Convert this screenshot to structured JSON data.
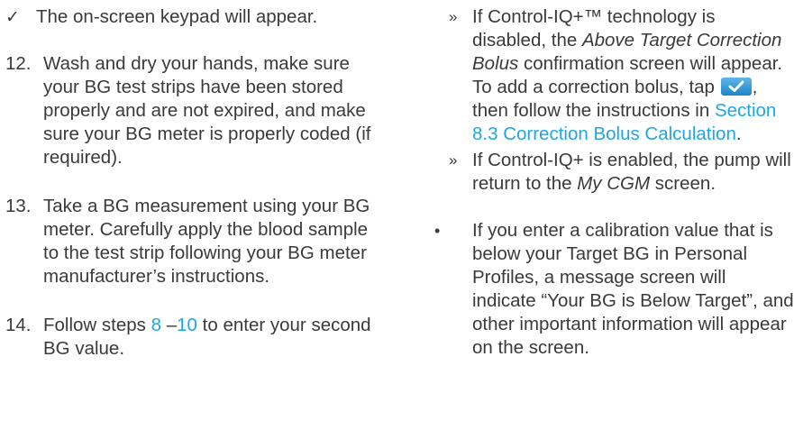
{
  "left": {
    "check_item": "The on-screen keypad will appear.",
    "check_symbol": "✓",
    "step12": {
      "num": "12.",
      "text": "Wash and dry your hands, make sure your BG test strips have been stored properly and are not expired, and make sure your BG meter is properly coded (if required)."
    },
    "step13": {
      "num": "13.",
      "text": "Take a BG measurement using your BG meter. Carefully apply the blood sample to the test strip following your BG meter manufacturer’s instructions."
    },
    "step14": {
      "num": "14.",
      "pre": "Follow steps ",
      "link_a": "8",
      "mid": " –",
      "link_b": "10",
      "post": " to enter your second BG value."
    }
  },
  "right": {
    "sub_bullet": "»",
    "sub1": {
      "pre": "If Control-IQ+™ technology is disabled, the ",
      "screen_name": "Above Target Correction Bolus",
      "mid": " confirmation screen will appear. To add a correction bolus, tap ",
      "after_icon": ", then follow the instructions in ",
      "link": "Section 8.3 Correction Bolus Calculation",
      "post": "."
    },
    "sub2": {
      "pre": "If Control-IQ+ is enabled, the pump will return to the ",
      "screen_name": "My CGM",
      "post": " screen."
    },
    "dot_symbol": "•",
    "bullet": "If you enter a calibration value that is below your Target BG in Personal Profiles, a message screen will indicate “Your BG is Below Target”, and other important information will appear on the screen."
  },
  "colors": {
    "text": "#3a3a3a",
    "link": "#1fa7e0",
    "button": "#1b86c8"
  },
  "icons": {
    "confirm_button": "checkmark-icon"
  }
}
